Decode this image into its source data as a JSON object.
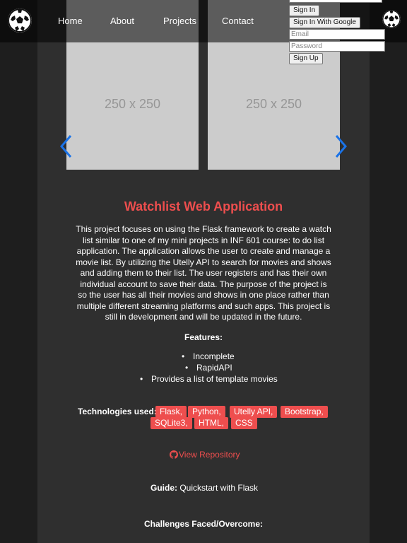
{
  "navbar": {
    "links": [
      "Home",
      "About",
      "Projects",
      "Contact"
    ],
    "logo_left": "soccer-ball-icon",
    "logo_right": "soccer-ball-icon"
  },
  "auth": {
    "sign_in_label": "Sign In",
    "google_label": "Sign In With Google",
    "email_placeholder": "Email",
    "password_placeholder": "Password",
    "sign_up_label": "Sign Up"
  },
  "carousel": {
    "slides": [
      "250 x 250",
      "250 x 250"
    ],
    "prev_icon": "chevron-left-icon",
    "next_icon": "chevron-right-icon",
    "arrow_color": "#1a73e8"
  },
  "project": {
    "title": "Watchlist Web Application",
    "description": "This project focuses on using the Flask framework to create a watch list similar to one of my mini projects in INF 601 course: to do list application. The application allows the user to create and manage a movie list. By utilizing the Utelly API to search for movies and shows and adding them to their list. The user registers and has their own individual account to save their data. The purpose of the project is so the user has all their movies and shows in one place rather than multiple different streaming platforms and such apps. This project is still in development and will be updated in the future.",
    "features_heading": "Features:",
    "features": [
      "Incomplete",
      "RapidAPI",
      "Provides a list of template movies"
    ],
    "tech_label": "Technologies used:",
    "technologies": [
      "Flask,",
      "Python,",
      "Utelly API,",
      "Bootstrap,",
      "SQLite3,",
      "HTML,",
      "CSS"
    ],
    "repo_label": "View Repository",
    "repo_icon": "github-icon",
    "guide_label": "Guide:",
    "guide_value": "Quickstart with Flask",
    "challenges_heading": "Challenges Faced/Overcome:",
    "accent_color": "#ee4e4e"
  }
}
